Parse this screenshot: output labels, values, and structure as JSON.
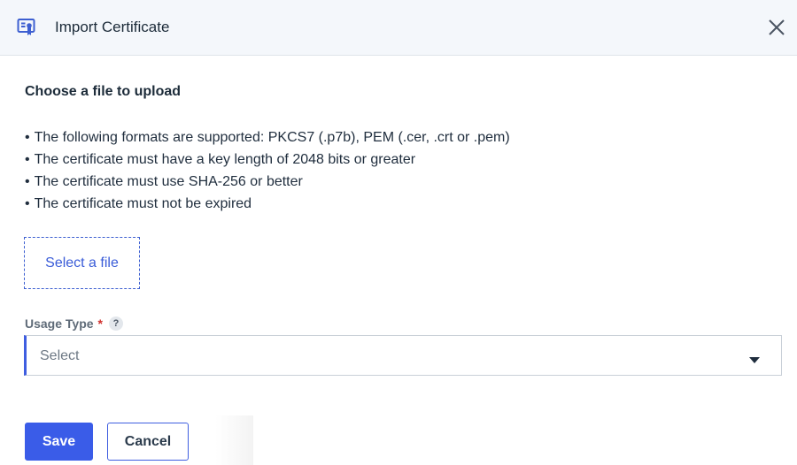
{
  "dialog": {
    "title": "Import Certificate",
    "header_icon": "certificate-icon",
    "close_icon": "close-icon"
  },
  "upload": {
    "heading": "Choose a file to upload",
    "requirements": [
      "The following formats are supported: PKCS7 (.p7b), PEM (.cer, .crt or .pem)",
      "The certificate must have a key length of 2048 bits or greater",
      "The certificate must use SHA-256 or better",
      "The certificate must not be expired"
    ],
    "select_file_label": "Select a file"
  },
  "usage_type": {
    "label": "Usage Type",
    "required_marker": "*",
    "help_glyph": "?",
    "placeholder": "Select"
  },
  "actions": {
    "save_label": "Save",
    "cancel_label": "Cancel"
  },
  "colors": {
    "accent": "#3a5ce8",
    "header_bg": "#f4f7fb",
    "required": "#d0312d"
  }
}
